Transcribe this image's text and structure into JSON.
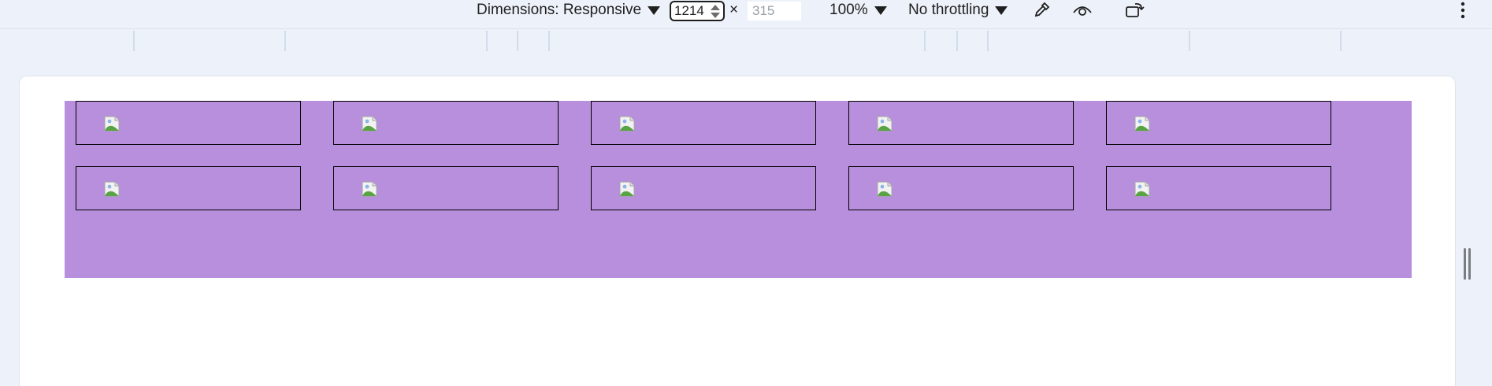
{
  "toolbar": {
    "dimensions_label": "Dimensions: Responsive",
    "width_value": "1214",
    "times_symbol": "×",
    "height_placeholder": "315",
    "zoom_label": "100%",
    "throttling_label": "No throttling",
    "icons": [
      "caret-down-icon",
      "eyedropper-icon",
      "eye-icon",
      "rotate-icon",
      "more-vert-icon"
    ]
  },
  "grid": {
    "rows": 2,
    "columns": 5,
    "cell_content": "broken-image-icon"
  },
  "colors": {
    "toolbar_bg": "#edf1f9",
    "container": "#b78fdc",
    "cell_border": "#000000",
    "viewport_bg": "#ffffff"
  }
}
